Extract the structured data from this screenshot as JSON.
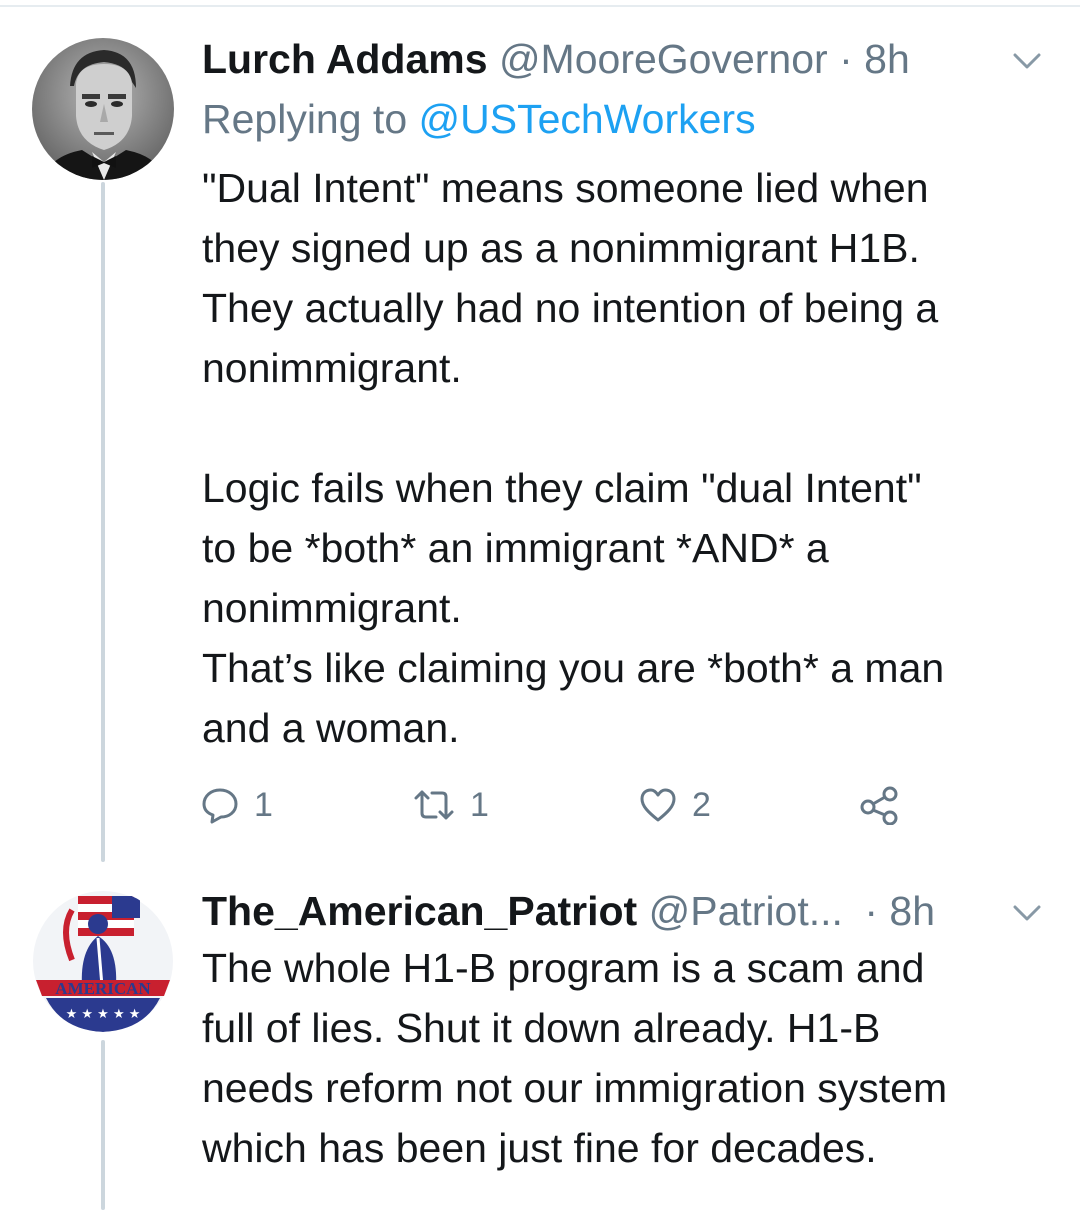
{
  "tweets": [
    {
      "display_name": "Lurch Addams",
      "handle": "@MooreGovernor",
      "separator": "·",
      "time": "8h",
      "replying_prefix": "Replying to ",
      "replying_to": "@USTechWorkers",
      "paragraph1": [
        "\"Dual Intent\" means someone lied when",
        "they signed up as a nonimmigrant H1B.",
        "They actually had no intention of being a",
        "nonimmigrant."
      ],
      "paragraph2": [
        "Logic fails when they claim \"dual Intent\"",
        "to be *both* an immigrant *AND* a",
        "nonimmigrant.",
        "That’s like claiming you are *both* a man",
        "and a woman."
      ],
      "actions": {
        "reply_count": "1",
        "retweet_count": "1",
        "like_count": "2"
      },
      "avatar_icon": "portrait-photo-icon"
    },
    {
      "display_name": "The_American_Patriot",
      "handle": "@Patriot...",
      "separator": "·",
      "time": "8h",
      "avatar_text": "AMERICAN",
      "body": [
        "The whole H1-B program is a scam and",
        "full of lies. Shut it down already. H1-B",
        "needs reform not our immigration system",
        "which has been just fine for decades."
      ],
      "avatar_icon": "patriot-flag-logo-icon"
    }
  ],
  "colors": {
    "text": "#14171a",
    "secondary": "#657786",
    "link": "#1da1f2",
    "thread_line": "#ccd6dd"
  }
}
